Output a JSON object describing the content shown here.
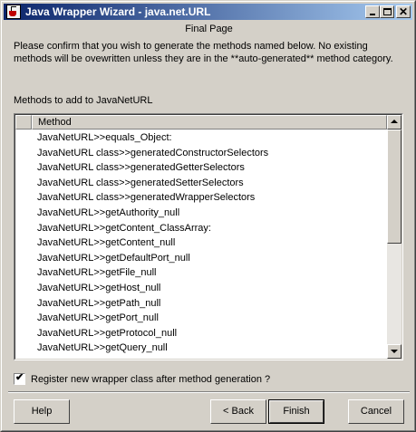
{
  "window": {
    "title": "Java Wrapper Wizard - java.net.URL"
  },
  "page": {
    "title": "Final Page",
    "description": "Please confirm that you wish to generate the methods named below.  No existing methods will be ovewritten unless they are in the **auto-generated** method category.",
    "methods_label": "Methods to add to JavaNetURL"
  },
  "list": {
    "column_header": "Method",
    "rows": [
      "JavaNetURL>>equals_Object:",
      "JavaNetURL class>>generatedConstructorSelectors",
      "JavaNetURL class>>generatedGetterSelectors",
      "JavaNetURL class>>generatedSetterSelectors",
      "JavaNetURL class>>generatedWrapperSelectors",
      "JavaNetURL>>getAuthority_null",
      "JavaNetURL>>getContent_ClassArray:",
      "JavaNetURL>>getContent_null",
      "JavaNetURL>>getDefaultPort_null",
      "JavaNetURL>>getFile_null",
      "JavaNetURL>>getHost_null",
      "JavaNetURL>>getPath_null",
      "JavaNetURL>>getPort_null",
      "JavaNetURL>>getProtocol_null",
      "JavaNetURL>>getQuery_null"
    ]
  },
  "options": {
    "register_label": "Register new wrapper class after method generation ?",
    "register_checked": true
  },
  "buttons": {
    "help": "Help",
    "back": "< Back",
    "finish": "Finish",
    "cancel": "Cancel"
  },
  "colors": {
    "title_gradient_start": "#0a246a",
    "title_gradient_end": "#a6caf0",
    "face": "#d4d0c8"
  }
}
